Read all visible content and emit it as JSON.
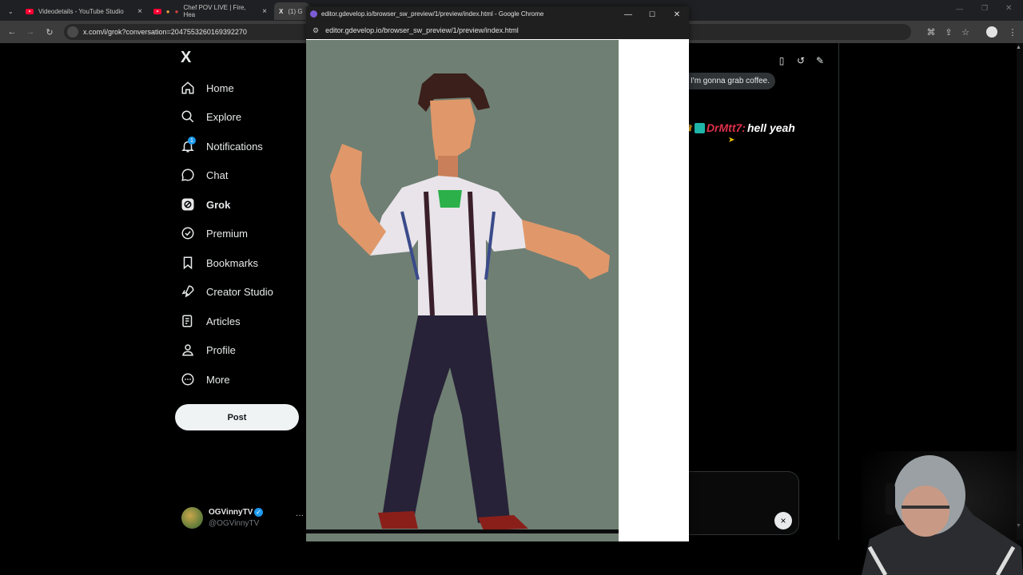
{
  "browser": {
    "tabs": [
      {
        "label": "Videodetails - YouTube Studio"
      },
      {
        "label": "Chef POV LIVE | Fire, Hea"
      },
      {
        "label": "(1) G"
      }
    ],
    "url": "x.com/i/grok?conversation=2047553260169392270"
  },
  "x_sidebar": {
    "logo": "X",
    "items": [
      {
        "label": "Home",
        "icon": "home-icon"
      },
      {
        "label": "Explore",
        "icon": "search-icon"
      },
      {
        "label": "Notifications",
        "icon": "bell-icon",
        "badge": "1"
      },
      {
        "label": "Chat",
        "icon": "chat-icon"
      },
      {
        "label": "Grok",
        "icon": "grok-icon",
        "active": true
      },
      {
        "label": "Premium",
        "icon": "premium-icon"
      },
      {
        "label": "Bookmarks",
        "icon": "bookmark-icon"
      },
      {
        "label": "Creator Studio",
        "icon": "rocket-icon"
      },
      {
        "label": "Articles",
        "icon": "articles-icon"
      },
      {
        "label": "Profile",
        "icon": "person-icon"
      },
      {
        "label": "More",
        "icon": "more-icon"
      }
    ],
    "post_button": "Post",
    "account": {
      "name": "OGVinnyTV",
      "handle": "@OGVinnyTV"
    }
  },
  "grok_panel": {
    "message": "I'm gonna grab coffee.",
    "input_close": "×"
  },
  "stream_chat": {
    "username": "DrMtt7:",
    "message": "hell yeah"
  },
  "popup": {
    "title": "editor.gdevelop.io/browser_sw_preview/1/preview/index.html - Google Chrome",
    "url": "editor.gdevelop.io/browser_sw_preview/1/preview/index.html"
  },
  "colors": {
    "x_blue": "#1d9bf0",
    "game_bg": "#6f7f73",
    "chat_name": "#e0304a"
  }
}
